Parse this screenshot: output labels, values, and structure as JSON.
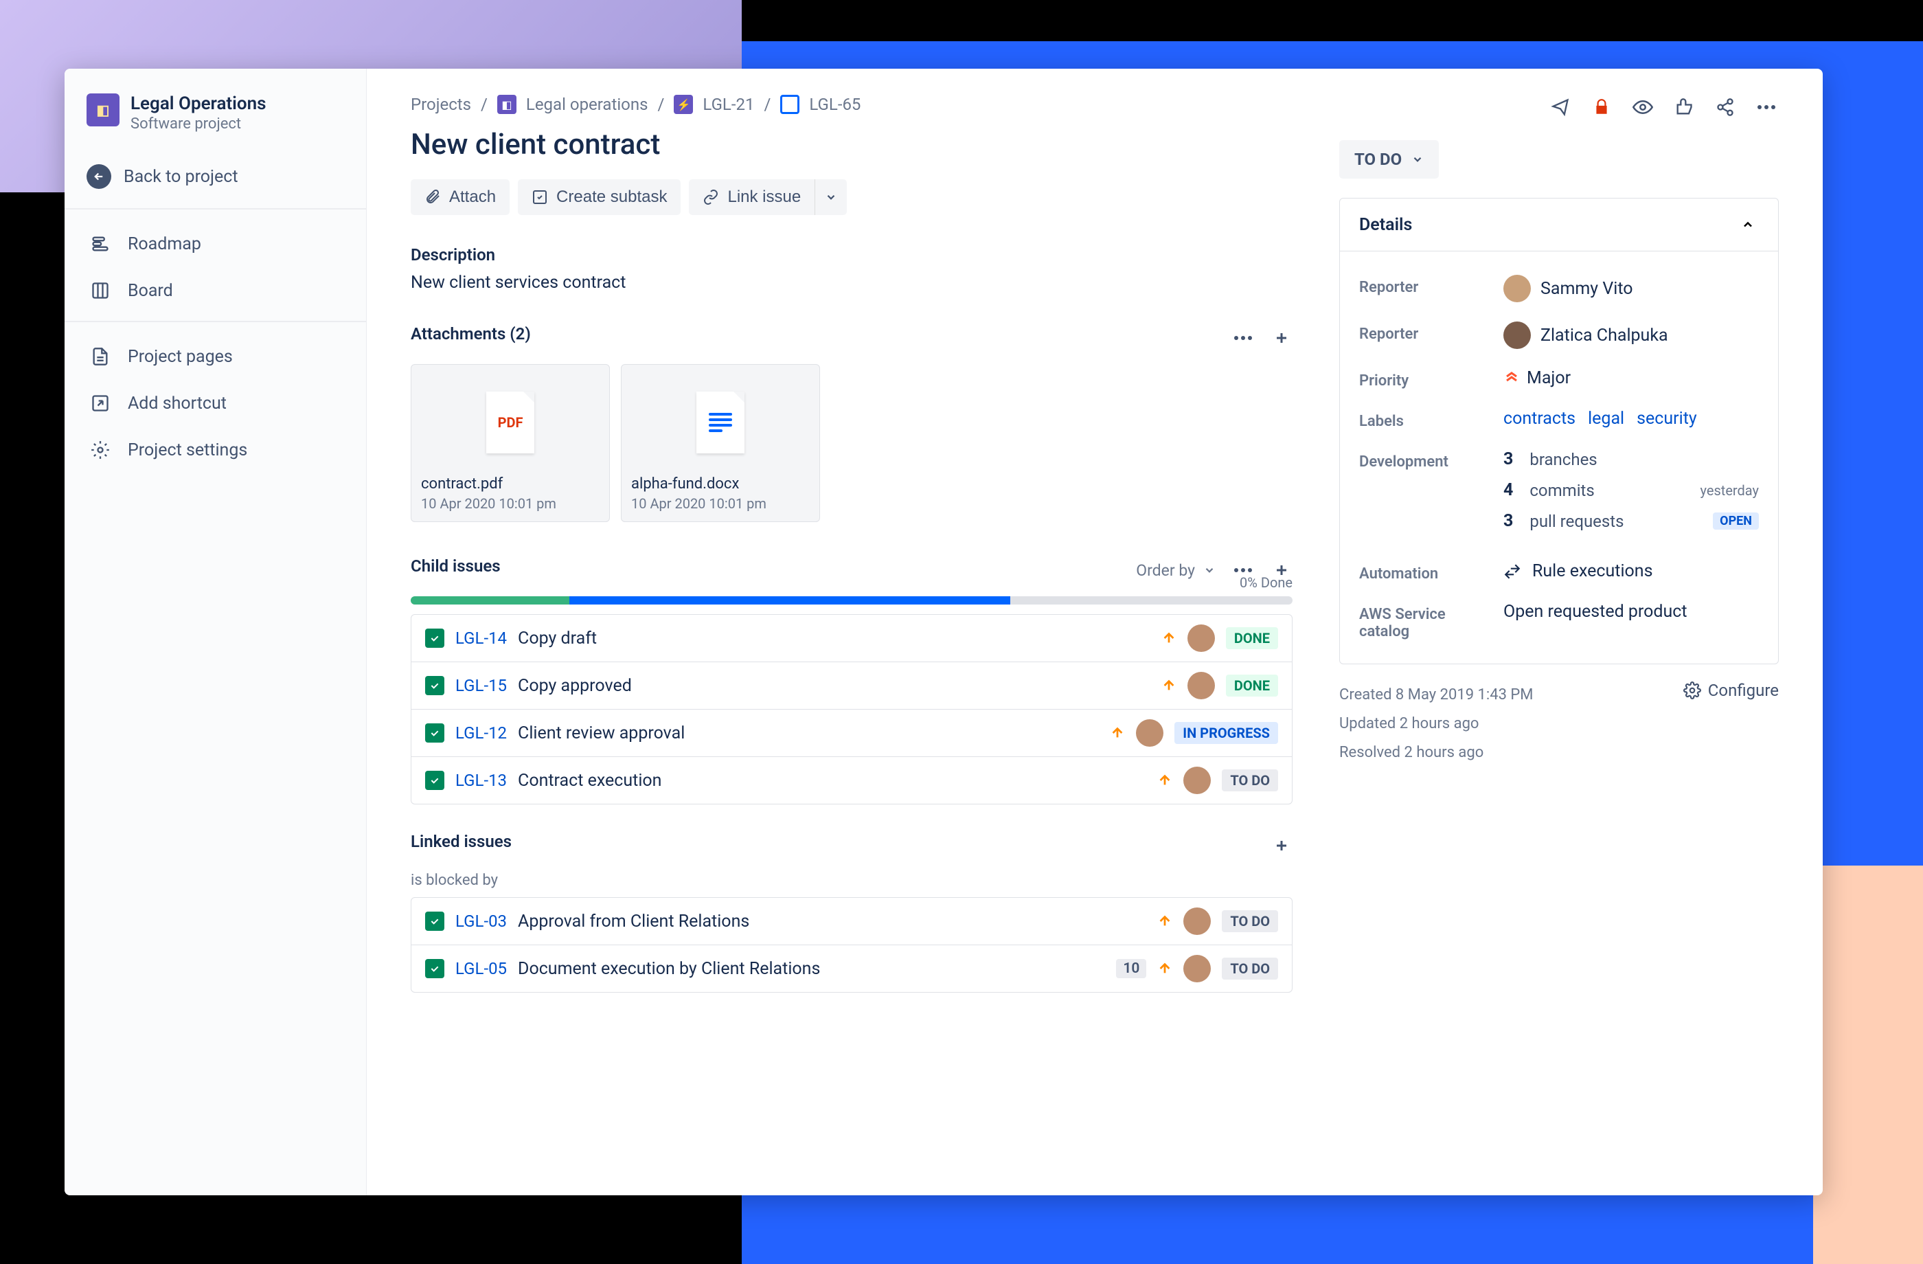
{
  "sidebar": {
    "project_name": "Legal Operations",
    "project_subtitle": "Software project",
    "back_label": "Back to project",
    "nav": [
      {
        "icon": "roadmap",
        "label": "Roadmap"
      },
      {
        "icon": "board",
        "label": "Board"
      }
    ],
    "nav2": [
      {
        "icon": "pages",
        "label": "Project pages"
      },
      {
        "icon": "shortcut",
        "label": "Add shortcut"
      },
      {
        "icon": "settings",
        "label": "Project settings"
      }
    ]
  },
  "breadcrumb": {
    "root": "Projects",
    "project": "Legal operations",
    "parent": "LGL-21",
    "current": "LGL-65"
  },
  "issue": {
    "title": "New client contract",
    "toolbar": {
      "attach": "Attach",
      "subtask": "Create subtask",
      "link": "Link issue"
    },
    "description_h": "Description",
    "description": "New client services contract",
    "attachments_h": "Attachments (2)",
    "attachments": [
      {
        "kind": "pdf",
        "name": "contract.pdf",
        "date": "10 Apr 2020 10:01 pm"
      },
      {
        "kind": "doc",
        "name": "alpha-fund.docx",
        "date": "10 Apr 2020 10:01 pm"
      }
    ],
    "child_h": "Child issues",
    "order_by": "Order by",
    "progress": {
      "green": 18,
      "blue": 50,
      "label": "0% Done"
    },
    "children": [
      {
        "key": "LGL-14",
        "title": "Copy draft",
        "status": "DONE",
        "status_class": "st-done"
      },
      {
        "key": "LGL-15",
        "title": "Copy approved",
        "status": "DONE",
        "status_class": "st-done"
      },
      {
        "key": "LGL-12",
        "title": "Client review approval",
        "status": "IN PROGRESS",
        "status_class": "st-progress"
      },
      {
        "key": "LGL-13",
        "title": "Contract execution",
        "status": "TO DO",
        "status_class": "st-todo"
      }
    ],
    "linked_h": "Linked issues",
    "linked_sub": "is blocked by",
    "linked": [
      {
        "key": "LGL-03",
        "title": "Approval from Client Relations",
        "status": "TO DO",
        "count": null
      },
      {
        "key": "LGL-05",
        "title": "Document execution by Client Relations",
        "status": "TO DO",
        "count": "10"
      }
    ]
  },
  "right": {
    "status": "TO DO",
    "details_h": "Details",
    "fields": {
      "reporter_label": "Reporter",
      "reporter1": "Sammy Vito",
      "reporter2": "Zlatica Chalpuka",
      "priority_label": "Priority",
      "priority": "Major",
      "labels_label": "Labels",
      "labels": [
        "contracts",
        "legal",
        "security"
      ],
      "dev_label": "Development",
      "dev": [
        {
          "n": "3",
          "t": "branches",
          "meta": ""
        },
        {
          "n": "4",
          "t": "commits",
          "meta": "yesterday"
        },
        {
          "n": "3",
          "t": "pull requests",
          "meta": "OPEN",
          "pill": true
        }
      ],
      "automation_label": "Automation",
      "automation": "Rule executions",
      "aws_label": "AWS Service catalog",
      "aws": "Open requested product"
    },
    "meta": {
      "created": "Created 8 May 2019 1:43 PM",
      "updated": "Updated 2 hours ago",
      "resolved": "Resolved 2 hours ago",
      "configure": "Configure"
    }
  }
}
